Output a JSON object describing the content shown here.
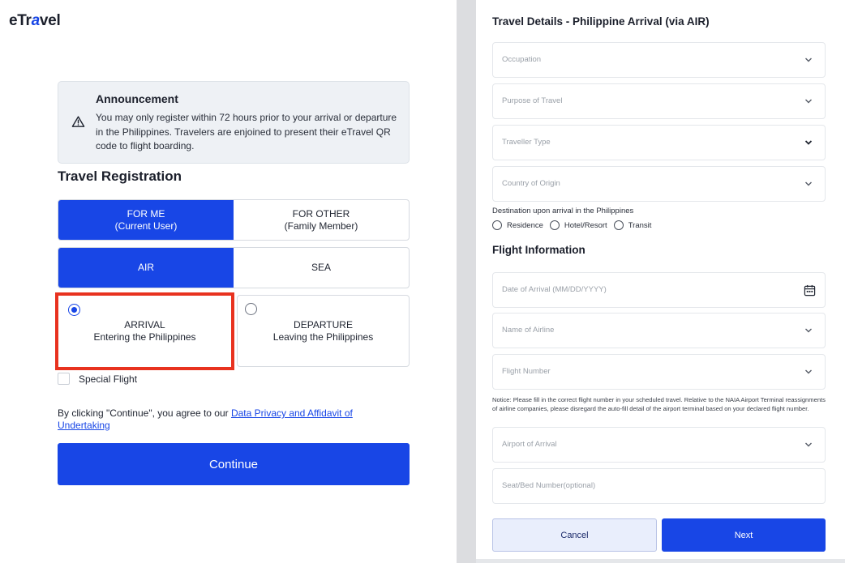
{
  "left": {
    "logo": {
      "prefix": "eTr",
      "accent": "a",
      "suffix": "vel"
    },
    "announcement": {
      "title": "Announcement",
      "body": "You may only register within 72 hours prior to your arrival or departure in the Philippines. Travelers are enjoined to present their eTravel QR code to flight boarding."
    },
    "section_title": "Travel Registration",
    "registrant": {
      "options": [
        {
          "line1": "FOR ME",
          "line2": "(Current User)"
        },
        {
          "line1": "FOR OTHER",
          "line2": "(Family Member)"
        }
      ]
    },
    "mode": {
      "options": [
        "AIR",
        "SEA"
      ]
    },
    "direction": {
      "arrival": {
        "title": "ARRIVAL",
        "subtitle": "Entering the Philippines"
      },
      "departure": {
        "title": "DEPARTURE",
        "subtitle": "Leaving the Philippines"
      }
    },
    "special_flight_label": "Special Flight",
    "agree_text": "By clicking \"Continue\", you agree to our ",
    "agree_link": "Data Privacy and Affidavit of Undertaking",
    "continue_label": "Continue"
  },
  "right": {
    "title": "Travel Details - Philippine Arrival (via AIR)",
    "fields_travel": {
      "occupation": "Occupation",
      "purpose": "Purpose of Travel",
      "traveller_type": "Traveller Type",
      "country": "Country of Origin"
    },
    "destination": {
      "label": "Destination upon arrival in the Philippines",
      "options": [
        "Residence",
        "Hotel/Resort",
        "Transit"
      ]
    },
    "flight_section": "Flight Information",
    "fields_flight": {
      "date": "Date of Arrival (MM/DD/YYYY)",
      "airline": "Name of Airline",
      "flight_number": "Flight Number",
      "airport": "Airport of Arrival",
      "seat": "Seat/Bed Number(optional)"
    },
    "notice": "Notice: Please fill in the correct flight number in your scheduled travel. Relative to the NAIA Airport Terminal reassignments of airline companies, please disregard the auto-fill detail of the airport terminal based on your declared flight number.",
    "cancel_label": "Cancel",
    "next_label": "Next"
  },
  "colors": {
    "primary": "#1846e6",
    "highlight": "#e8321f",
    "announcement_bg": "#eef1f5"
  },
  "icons": {
    "warning": "warning-icon",
    "chevron": "chevron-down-icon",
    "calendar": "calendar-icon"
  }
}
